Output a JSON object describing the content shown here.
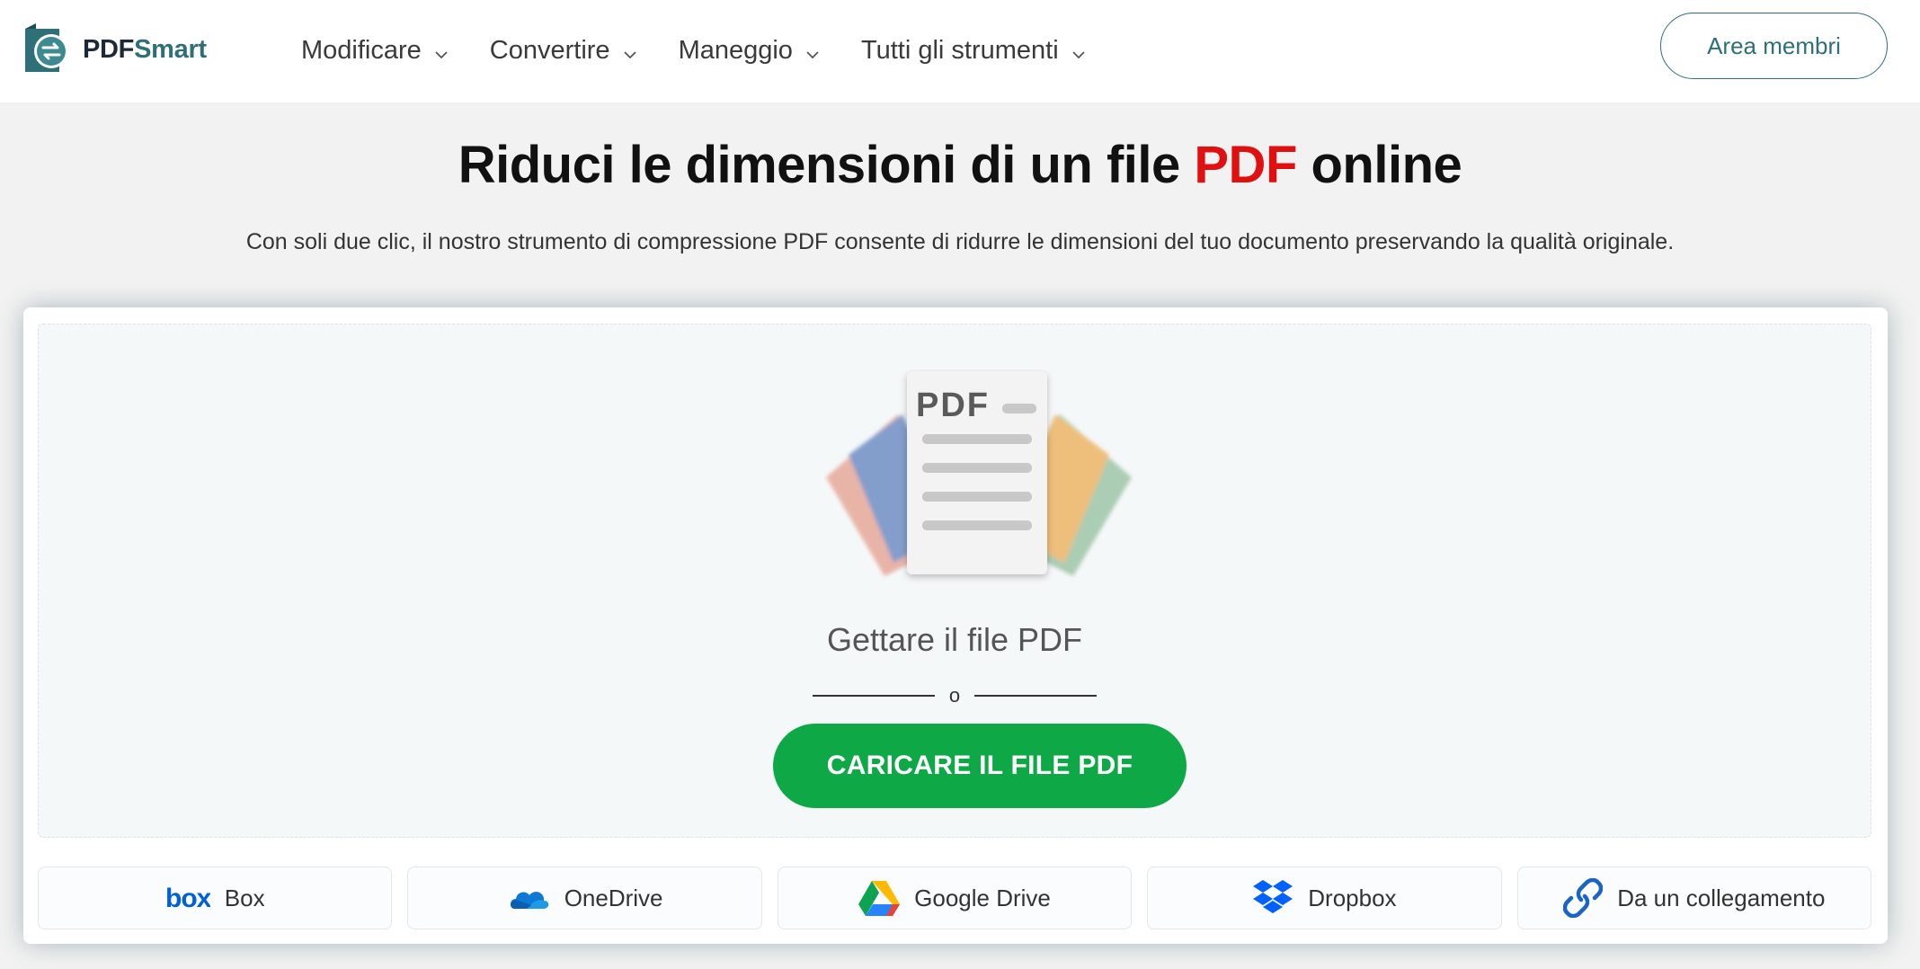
{
  "header": {
    "logo": {
      "part1": "PDF",
      "part2": "Smart"
    },
    "nav": [
      {
        "label": "Modificare"
      },
      {
        "label": "Convertire"
      },
      {
        "label": "Maneggio"
      },
      {
        "label": "Tutti gli strumenti"
      }
    ],
    "member_button": "Area membri"
  },
  "hero": {
    "title_before": "Riduci le dimensioni di un file ",
    "title_accent": "PDF",
    "title_after": " online",
    "subtitle": "Con soli due clic, il nostro strumento di compressione PDF consente di ridurre le dimensioni del tuo documento preservando la qualità originale."
  },
  "upload": {
    "illustration_label": "PDF",
    "drop_text": "Gettare il file PDF",
    "or_text": "o",
    "button": "CARICARE IL FILE PDF"
  },
  "sources": [
    {
      "label": "Box",
      "icon": "box-icon"
    },
    {
      "label": "OneDrive",
      "icon": "onedrive-icon"
    },
    {
      "label": "Google Drive",
      "icon": "google-drive-icon"
    },
    {
      "label": "Dropbox",
      "icon": "dropbox-icon"
    },
    {
      "label": "Da un collegamento",
      "icon": "link-icon"
    }
  ],
  "colors": {
    "accent_red": "#e01010",
    "brand_teal": "#2f6f77",
    "upload_green": "#0ea846"
  }
}
